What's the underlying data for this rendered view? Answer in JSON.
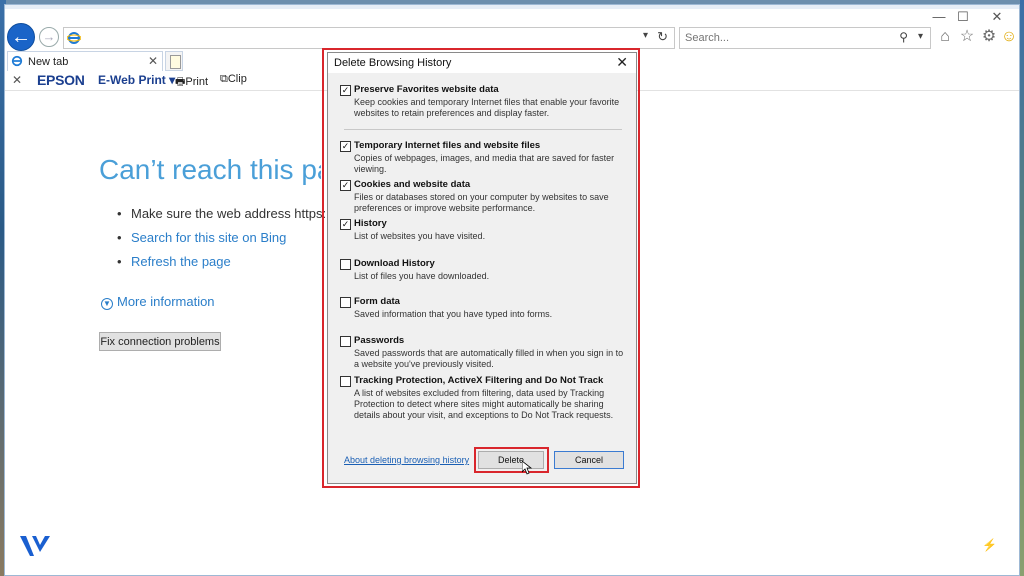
{
  "browser": {
    "search_placeholder": "Search...",
    "tab_label": "New tab",
    "favorites": {
      "epson": "EPSON",
      "eweb_print": "E-Web Print ▾",
      "print": "Print",
      "clip": "Clip"
    }
  },
  "error_page": {
    "title": "Can’t reach this page",
    "bullets": {
      "address": "Make sure the web address https://",
      "search_bing": "Search for this site on Bing",
      "refresh": "Refresh the page"
    },
    "more_info": "More information",
    "fix_button": "Fix connection problems"
  },
  "dialog": {
    "title": "Delete Browsing History",
    "options": [
      {
        "name": "Preserve Favorites website data",
        "desc": "Keep cookies and temporary Internet files that enable your favorite websites to retain preferences and display faster.",
        "checked": true
      },
      {
        "name": "Temporary Internet files and website files",
        "desc": "Copies of webpages, images, and media that are saved for faster viewing.",
        "checked": true
      },
      {
        "name": "Cookies and website data",
        "desc": "Files or databases stored on your computer by websites to save preferences or improve website performance.",
        "checked": true
      },
      {
        "name": "History",
        "desc": "List of websites you have visited.",
        "checked": true
      },
      {
        "name": "Download History",
        "desc": "List of files you have downloaded.",
        "checked": false
      },
      {
        "name": "Form data",
        "desc": "Saved information that you have typed into forms.",
        "checked": false
      },
      {
        "name": "Passwords",
        "desc": "Saved passwords that are automatically filled in when you sign in to a website you've previously visited.",
        "checked": false
      },
      {
        "name": "Tracking Protection, ActiveX Filtering and Do Not Track",
        "desc": "A list of websites excluded from filtering, data used by Tracking Protection to detect where sites might automatically be sharing details about your visit, and exceptions to Do Not Track requests.",
        "checked": false
      }
    ],
    "about_link": "About deleting browsing history",
    "delete_button": "Delete",
    "cancel_button": "Cancel"
  },
  "colors": {
    "highlight_red": "#d9262c",
    "link_blue": "#2a7ec9",
    "title_blue": "#4a9fd8"
  }
}
